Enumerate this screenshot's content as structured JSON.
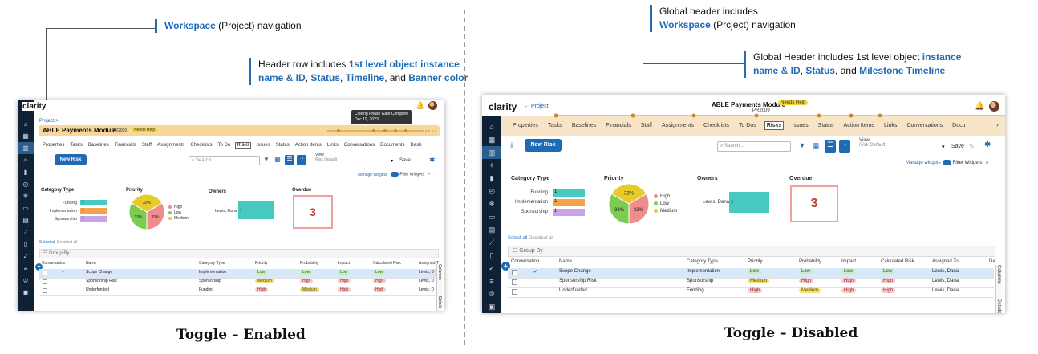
{
  "left": {
    "callout1": {
      "label": "Workspace",
      "rest": " (Project) navigation"
    },
    "callout2": {
      "l1_pre": "Header row includes ",
      "l1_hl": "1st level object instance",
      "l2_hl1": "name & ID",
      "l2_c1": ", ",
      "l2_hl2": "Status",
      "l2_c2": ", ",
      "l2_hl3": "Timeline",
      "l2_and": ", and ",
      "l2_hl4": "Banner color"
    },
    "caption": "Toggle – Enabled",
    "app": {
      "brand": "clarity",
      "breadcrumb": "Project >",
      "title": "ABLE Payments Module",
      "id": "PR2009",
      "status": "Needs Help",
      "tooltip": {
        "line1": "Closing Phase Gate Complete",
        "line2": "Dec 19, 2023"
      },
      "tabs": [
        "Properties",
        "Tasks",
        "Baselines",
        "Financials",
        "Staff",
        "Assignments",
        "Checklists",
        "To Do",
        "Risks",
        "Issues",
        "Status",
        "Action Items",
        "Links",
        "Conversations",
        "Documents",
        "Dash"
      ],
      "new_btn": "New Risk",
      "search_placeholder": "Search...",
      "view_label": "View",
      "view_value": "Risk Default",
      "save": "Save",
      "manage": "Manage widgets",
      "filter": "Filter Widgets",
      "w_category": "Category Type",
      "w_priority": "Priority",
      "w_owners": "Owners",
      "w_overdue": "Overdue",
      "categories": [
        {
          "label": "Funding",
          "value": "1",
          "color": "#45c9c0"
        },
        {
          "label": "Implementation",
          "value": "1",
          "color": "#f5a34b"
        },
        {
          "label": "Sponsorship",
          "value": "1",
          "color": "#c8a3ea"
        }
      ],
      "priority_legend": [
        {
          "label": "High",
          "color": "#f08c8c"
        },
        {
          "label": "Low",
          "color": "#7ccc4f"
        },
        {
          "label": "Medium",
          "color": "#e6cc2a"
        }
      ],
      "pie_labels": [
        "33%",
        "33%",
        "33%"
      ],
      "owner": {
        "name": "Lewis, Dana",
        "value": "1"
      },
      "overdue_value": "3",
      "select_all": "Select all",
      "deselect_all": "Deselect all",
      "group_by": "Group By",
      "columns": [
        "Conversation",
        "Name",
        "Category Type",
        "Priority",
        "Probability",
        "Impact",
        "Calculated Risk",
        "Assigned T"
      ],
      "rows": [
        {
          "name": "Scope Change",
          "category": "Implementation",
          "priority": "Low",
          "probability": "Low",
          "impact": "Low",
          "calc": "Low",
          "assigned": "Lewis, D",
          "check": "✔"
        },
        {
          "name": "Sponsorship Risk",
          "category": "Sponsorship",
          "priority": "Medium",
          "probability": "High",
          "impact": "High",
          "calc": "High",
          "assigned": "Lewis, D",
          "check": ""
        },
        {
          "name": "Underfunded",
          "category": "Funding",
          "priority": "High",
          "probability": "Medium",
          "impact": "High",
          "calc": "High",
          "assigned": "Lewis, D",
          "check": ""
        }
      ],
      "side_tabs": [
        "Columns",
        "Details"
      ]
    }
  },
  "right": {
    "callout1": {
      "l1": "Global header includes",
      "label": "Workspace",
      "rest": " (Prcject) navigation"
    },
    "callout2": {
      "l1_pre": "Global Header includes 1st level object ",
      "l1_hl": "instance",
      "l2_hl1": "name & ID",
      "l2_c1": ", ",
      "l2_hl2": "Status",
      "l2_and": ", and ",
      "l2_hl3": "Milestone Timeline"
    },
    "caption": "Toggle – Disabled",
    "app": {
      "brand": "clarity",
      "back": "← Project",
      "title": "ABLE Payments Module",
      "id": "PR2009",
      "status": "Needs Help",
      "tabs": [
        "Properties",
        "Tasks",
        "Baselines",
        "Financials",
        "Staff",
        "Assignments",
        "Checklists",
        "To Dos",
        "Risks",
        "Issues",
        "Status",
        "Action Items",
        "Links",
        "Conversations",
        "Docu"
      ],
      "new_btn": "New Risk",
      "search_placeholder": "Search...",
      "view_label": "View",
      "view_value": "Risk Default",
      "save": "Save",
      "manage": "Manage widgets",
      "filter": "Filter Widgets",
      "w_category": "Category Type",
      "w_priority": "Priority",
      "w_owners": "Owners",
      "w_overdue": "Overdue",
      "categories": [
        {
          "label": "Funding",
          "value": "1",
          "color": "#45c9c0"
        },
        {
          "label": "Implementation",
          "value": "1",
          "color": "#f5a34b"
        },
        {
          "label": "Sponsorship",
          "value": "1",
          "color": "#c8a3ea"
        }
      ],
      "priority_legend": [
        {
          "label": "High",
          "color": "#f08c8c"
        },
        {
          "label": "Low",
          "color": "#7ccc4f"
        },
        {
          "label": "Medium",
          "color": "#e6cc2a"
        }
      ],
      "pie_labels": [
        "33%",
        "33%",
        "33%"
      ],
      "owner": {
        "name": "Lewis, Dana",
        "value": "1"
      },
      "overdue_value": "3",
      "select_all": "Select all",
      "deselect_all": "Deselect all",
      "group_by": "Group By",
      "columns": [
        "Conversation",
        "Name",
        "Category Type",
        "Priority",
        "Probability",
        "Impact",
        "Calculated Risk",
        "Assigned To",
        "Da"
      ],
      "rows": [
        {
          "name": "Scope Change",
          "category": "Implementation",
          "priority": "Low",
          "probability": "Low",
          "impact": "Low",
          "calc": "Low",
          "assigned": "Lewis, Dana",
          "check": "✔"
        },
        {
          "name": "Sponsorship Risk",
          "category": "Sponsorship",
          "priority": "Medium",
          "probability": "High",
          "impact": "High",
          "calc": "High",
          "assigned": "Lewis, Dana",
          "check": ""
        },
        {
          "name": "Underfunded",
          "category": "Funding",
          "priority": "High",
          "probability": "Medium",
          "impact": "High",
          "calc": "High",
          "assigned": "Lewis, Dana",
          "check": ""
        }
      ],
      "side_tabs": [
        "Columns",
        "Details"
      ]
    }
  },
  "icons": {
    "sidebar": [
      "home-icon",
      "grid-icon",
      "chart-icon",
      "bulb-icon",
      "bar-icon",
      "gauge-icon",
      "snow-icon",
      "monitor-icon",
      "db-icon",
      "trend-icon",
      "doc-icon",
      "check-icon",
      "list-icon",
      "org-icon",
      "clip-icon"
    ]
  }
}
